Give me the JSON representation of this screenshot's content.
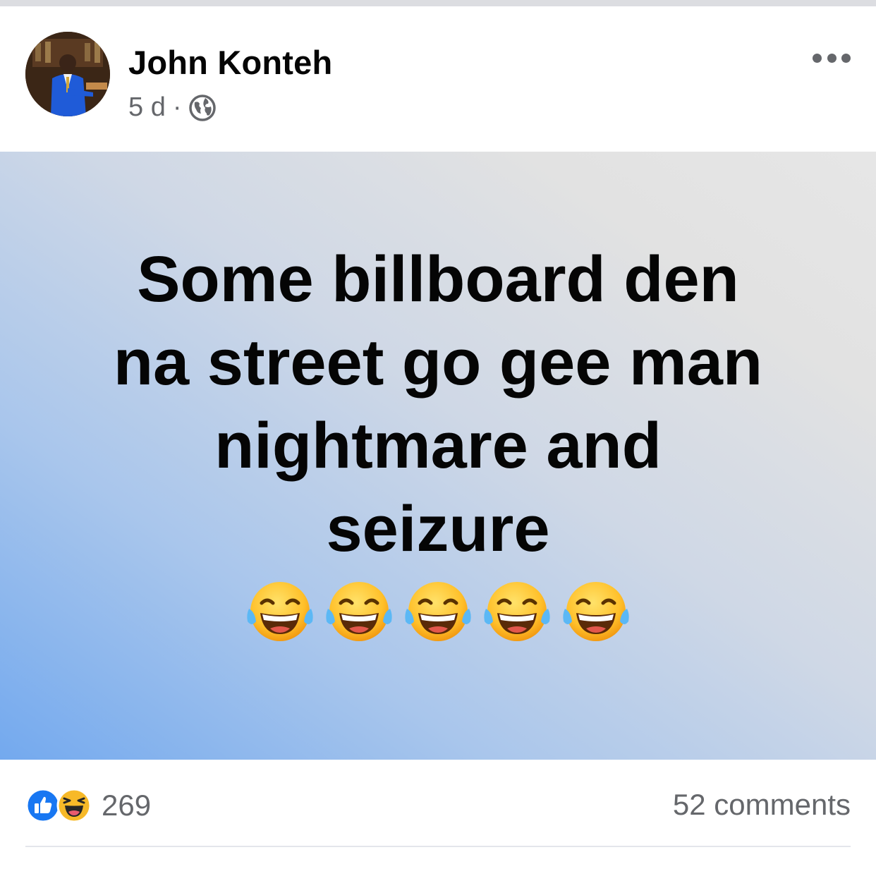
{
  "post": {
    "author": "John Konteh",
    "time": "5 d",
    "separator": "·",
    "privacy_icon": "globe-icon",
    "more_icon": "more-options-icon",
    "text_lines": [
      "Some billboard den",
      "na street go gee man",
      "nightmare and",
      "seizure"
    ],
    "emoji": "face-with-tears-of-joy",
    "emoji_count": 5,
    "colors": {
      "gradient_start": "#73a9ee",
      "gradient_end": "#e6e6e6",
      "like_blue": "#1877f2",
      "haha_yellow": "#f7b928"
    }
  },
  "footer": {
    "reaction_icons": [
      "like-icon",
      "haha-icon"
    ],
    "reaction_count": "269",
    "comments": "52 comments"
  }
}
